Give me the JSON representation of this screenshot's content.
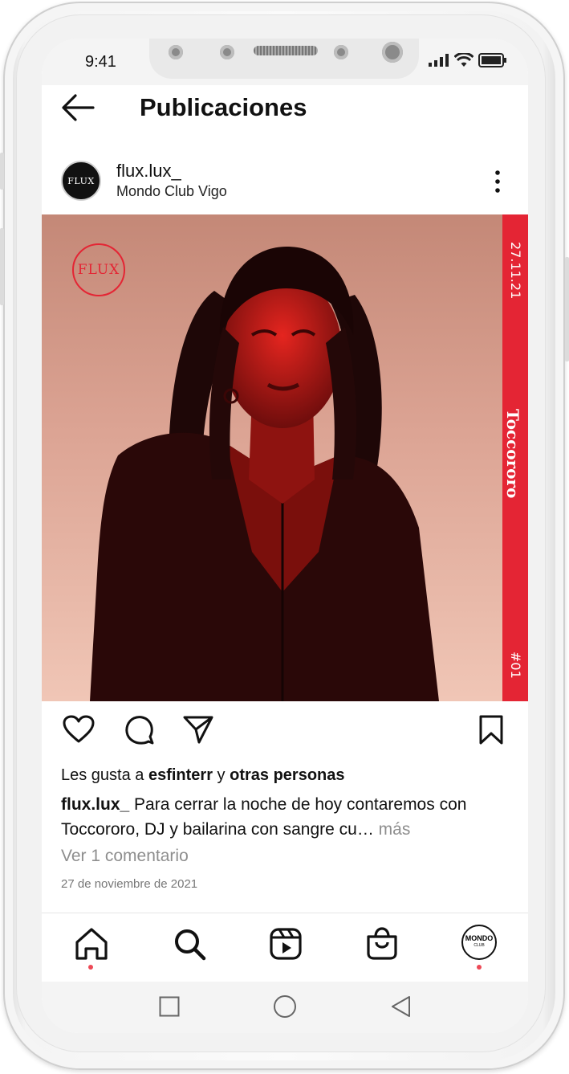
{
  "status_bar": {
    "time": "9:41"
  },
  "header": {
    "title": "Publicaciones"
  },
  "post": {
    "username": "flux.lux_",
    "location": "Mondo Club Vigo",
    "avatar_text": "FLUX",
    "image": {
      "logo_text": "FLUX",
      "date": "27.11.21",
      "artist": "Toccororo",
      "number": "#01"
    },
    "likes": {
      "prefix": "Les gusta a ",
      "user": "esfinterr",
      "connector": " y ",
      "others": "otras personas"
    },
    "caption": {
      "user": "flux.lux_",
      "text": " Para cerrar la noche de hoy contaremos con Toccororo, DJ y bailarina con sangre cu…",
      "more": " más"
    },
    "comments_link": "Ver 1 comentario",
    "date": "27 de noviembre de 2021"
  },
  "tabbar": {
    "profile_label_top": "MONDO",
    "profile_label_bottom": "CLUB"
  },
  "colors": {
    "accent_red": "#e42534",
    "notification_dot": "#ed4956"
  }
}
